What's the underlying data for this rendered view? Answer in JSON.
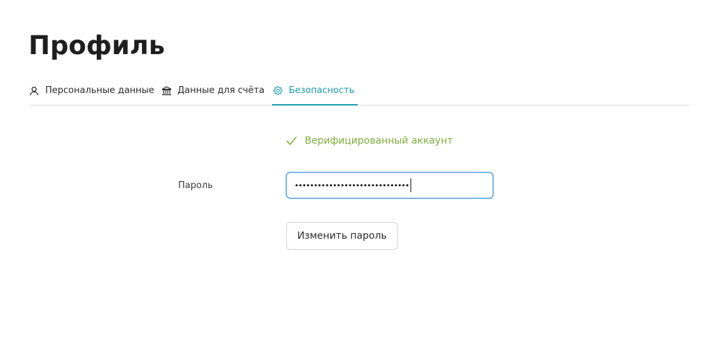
{
  "page": {
    "title": "Профиль"
  },
  "tabs": [
    {
      "label": "Персональные данные",
      "icon": "user-icon",
      "active": false
    },
    {
      "label": "Данные для счёта",
      "icon": "bank-icon",
      "active": false
    },
    {
      "label": "Безопасность",
      "icon": "gear-icon",
      "active": true
    }
  ],
  "security": {
    "verified_text": "Верифицированный аккаунт",
    "verified_icon": "check-icon",
    "password_label": "Пароль",
    "password_value": "••••••••••••••••••••••••••••••",
    "change_password_label": "Изменить пароль"
  },
  "colors": {
    "accent": "#1a9aab",
    "verified": "#7fae3a",
    "input_focus": "#2f8fd6"
  }
}
